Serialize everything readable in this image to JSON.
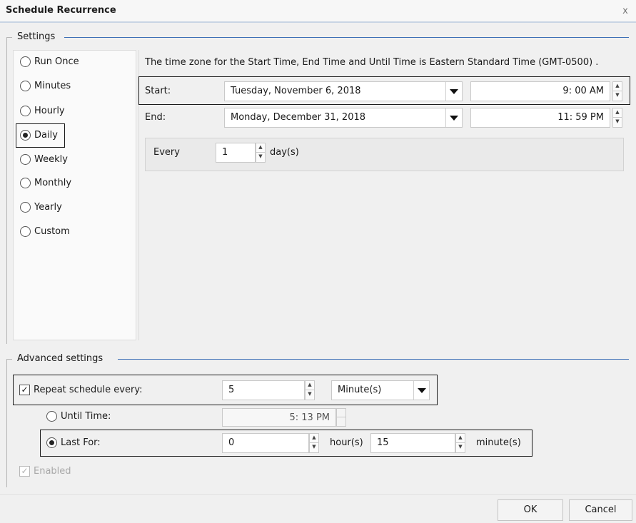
{
  "window": {
    "title": "Schedule Recurrence",
    "close_glyph": "x"
  },
  "settings": {
    "group_label": "Settings",
    "recurrence_options": [
      {
        "label": "Run Once",
        "selected": false
      },
      {
        "label": "Minutes",
        "selected": false
      },
      {
        "label": "Hourly",
        "selected": false
      },
      {
        "label": "Daily",
        "selected": true
      },
      {
        "label": "Weekly",
        "selected": false
      },
      {
        "label": "Monthly",
        "selected": false
      },
      {
        "label": "Yearly",
        "selected": false
      },
      {
        "label": "Custom",
        "selected": false
      }
    ],
    "timezone_note": "The time zone for the Start Time, End Time and Until Time is Eastern Standard Time (GMT-0500) .",
    "start": {
      "label": "Start:",
      "date": "Tuesday, November 6, 2018",
      "time": "9: 00 AM"
    },
    "end": {
      "label": "End:",
      "date": "Monday, December 31, 2018",
      "time": "11: 59 PM"
    },
    "every": {
      "label": "Every",
      "value": "1",
      "unit": "day(s)"
    }
  },
  "advanced": {
    "group_label": "Advanced settings",
    "repeat": {
      "label": "Repeat schedule every:",
      "checked": true,
      "value": "5",
      "unit": "Minute(s)"
    },
    "until_time": {
      "label": "Until Time:",
      "selected": false,
      "value": "5: 13 PM"
    },
    "last_for": {
      "label": "Last For:",
      "selected": true,
      "hours": "0",
      "hours_unit": "hour(s)",
      "minutes": "15",
      "minutes_unit": "minute(s)"
    },
    "enabled": {
      "label": "Enabled",
      "checked": true,
      "disabled": true
    }
  },
  "buttons": {
    "ok": "OK",
    "cancel": "Cancel"
  },
  "colors": {
    "accent_line": "#3d6fb6",
    "dialog_bg": "#f0f0f0"
  },
  "icons": {
    "spinner_up": "▲",
    "spinner_down": "▼",
    "checkmark": "✓"
  }
}
